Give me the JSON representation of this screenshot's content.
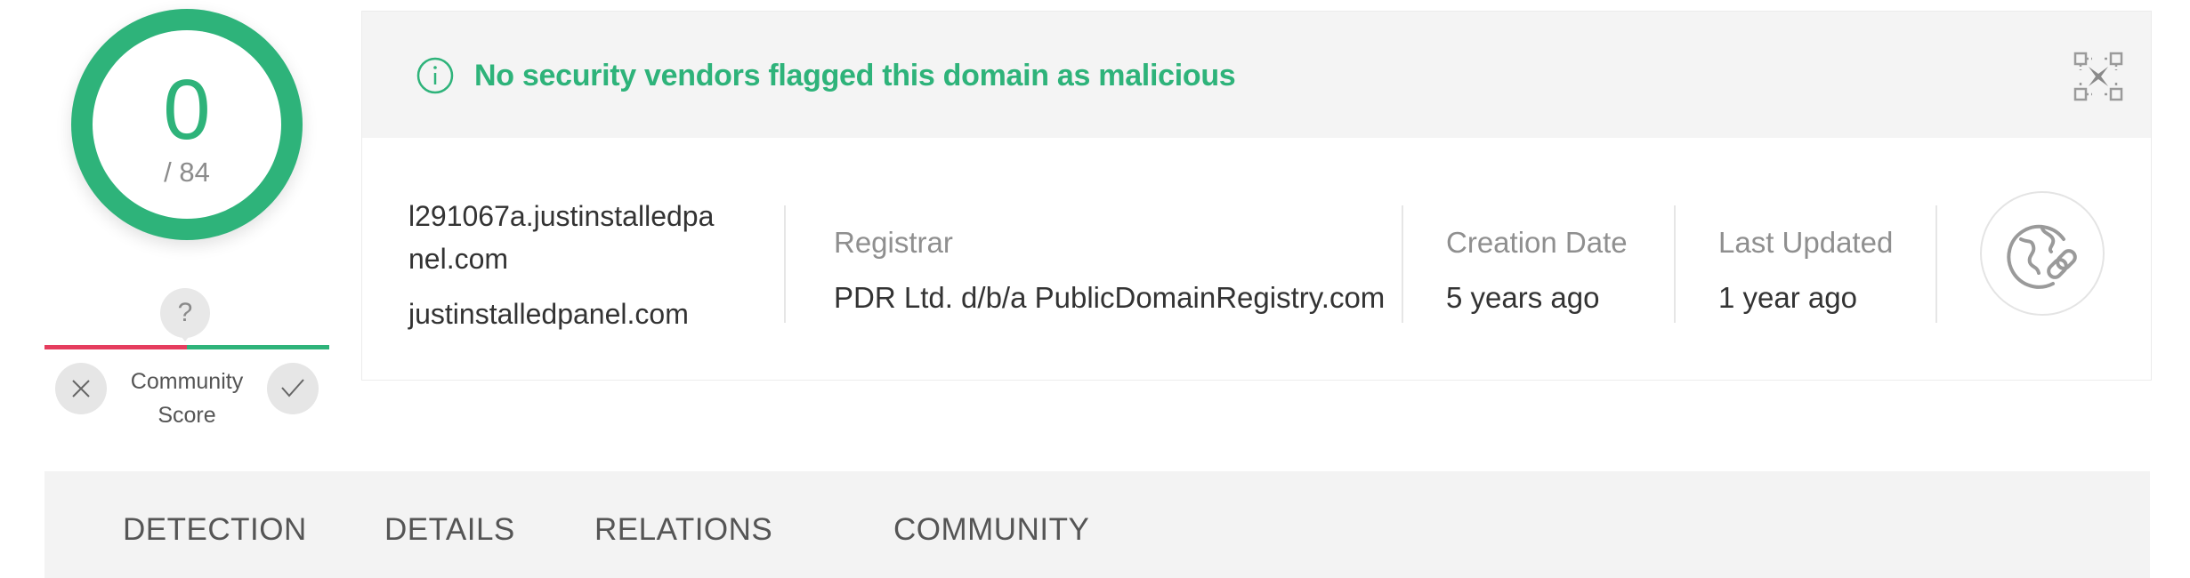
{
  "score": {
    "detections": "0",
    "total": "/ 84",
    "ring_color": "#2eb37a"
  },
  "community": {
    "unknown_symbol": "?",
    "label_line1": "Community",
    "label_line2": "Score",
    "downvote_icon": "close-icon",
    "upvote_icon": "check-icon",
    "negative_color": "#e53d5e",
    "positive_color": "#2eb37a"
  },
  "banner": {
    "message": "No security vendors flagged this domain as malicious",
    "icon": "info-icon",
    "action_icon": "qr-code-icon",
    "color": "#2eb37a"
  },
  "domain": {
    "full_line1": "l291067a.justinstalledpa",
    "full_line2": "nel.com",
    "root": "justinstalledpanel.com"
  },
  "fields": {
    "registrar_label": "Registrar",
    "registrar_value": "PDR Ltd. d/b/a PublicDomainRegistry.com",
    "creation_label": "Creation Date",
    "creation_value": "5 years ago",
    "updated_label": "Last Updated",
    "updated_value": "1 year ago"
  },
  "graph_button_icon": "globe-link-icon",
  "tabs": [
    {
      "label": "DETECTION"
    },
    {
      "label": "DETAILS"
    },
    {
      "label": "RELATIONS"
    },
    {
      "label": "COMMUNITY"
    }
  ]
}
